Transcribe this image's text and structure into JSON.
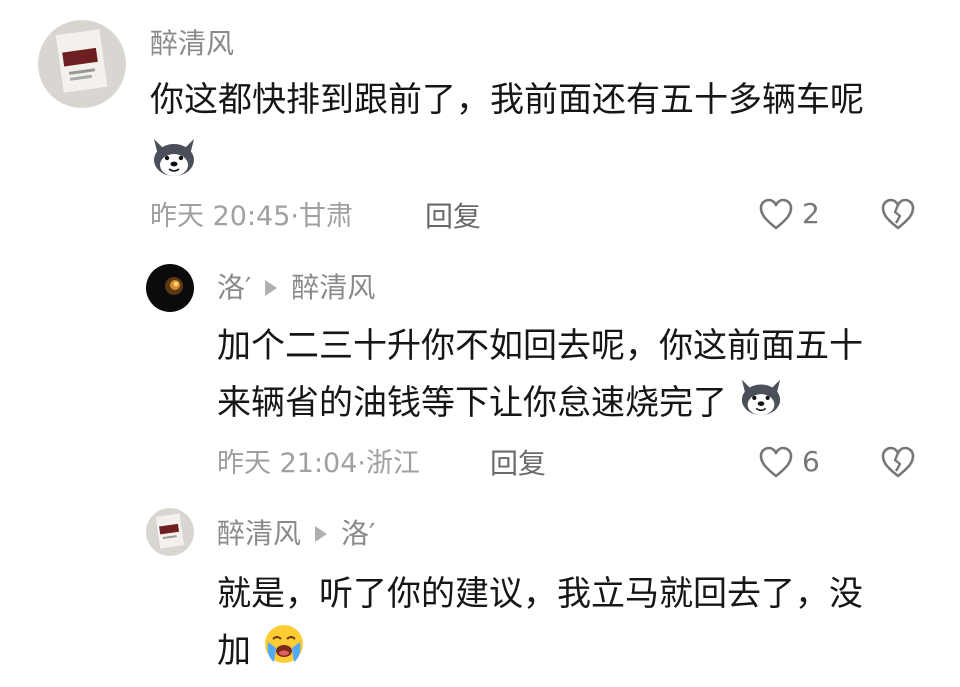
{
  "comments": [
    {
      "username": "醉清风",
      "text_lines": [
        "你这都快排到跟前了，我前面还有五十多辆车呢"
      ],
      "time": "昨天 20:45·",
      "location": "甘肃",
      "reply_label": "回复",
      "like_count": "2",
      "emoji": "husky-emoji"
    },
    {
      "username": "洛′",
      "reply_to": "醉清风",
      "text_lines": [
        "加个二三十升你不如回去呢，你这前面五十",
        "来辆省的油钱等下让你怠速烧完了"
      ],
      "time": "昨天 21:04·",
      "location": "浙江",
      "reply_label": "回复",
      "like_count": "6",
      "emoji": "husky-emoji"
    },
    {
      "username": "醉清风",
      "reply_to": "洛′",
      "text_lines": [
        "就是，听了你的建议，我立马就回去了，没",
        "加"
      ],
      "emoji": "crying-face-emoji"
    }
  ],
  "colors": {
    "meta_gray": "#a0a0a0",
    "text": "#161616",
    "icon_gray": "#777777"
  }
}
